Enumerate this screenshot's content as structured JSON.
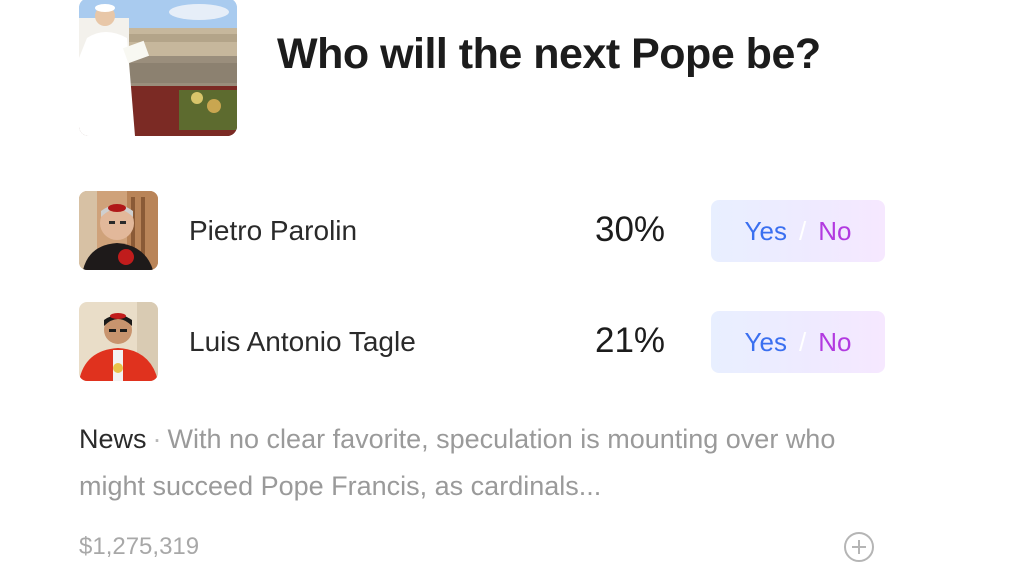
{
  "market": {
    "title": "Who will the next Pope be?",
    "hero_image": "pope-on-balcony-photo"
  },
  "outcomes": [
    {
      "name": "Pietro Parolin",
      "percent": "30%",
      "yes_label": "Yes",
      "no_label": "No",
      "separator": "/",
      "avatar": "pietro-parolin-photo"
    },
    {
      "name": "Luis Antonio Tagle",
      "percent": "21%",
      "yes_label": "Yes",
      "no_label": "No",
      "separator": "/",
      "avatar": "luis-antonio-tagle-photo"
    }
  ],
  "news": {
    "label": "News",
    "separator": "·",
    "text": "With no clear favorite, speculation is mounting over who might succeed Pope Francis, as cardinals..."
  },
  "footer": {
    "volume": "$1,275,319",
    "add_icon": "plus-circle-icon"
  },
  "colors": {
    "yes": "#3a6ff0",
    "no": "#b23ae0",
    "muted_text": "#9a9a9a"
  }
}
